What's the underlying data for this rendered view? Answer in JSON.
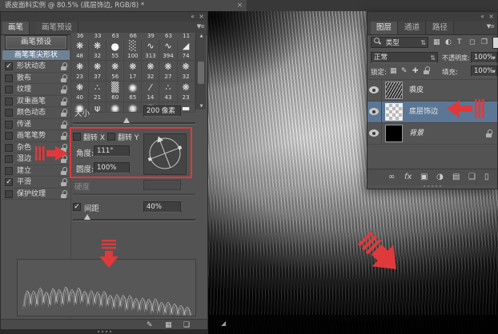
{
  "window": {
    "doc_tab_title": "裘皮面料实例 @ 80.5% (底层饰边, RGB/8) *",
    "doc_tab_close": "×"
  },
  "icons": {
    "check": "✓",
    "reset": "↺",
    "collapse": "«",
    "close": "×",
    "panel_menu": "▼≡",
    "updown": "⇅",
    "dropdown": "▾",
    "scroll_up": "▲",
    "scroll_down": "▼",
    "grip": "◢"
  },
  "brush_panel": {
    "tab_brush": "画笔",
    "tab_presets": "画笔预设",
    "preset_button": "画笔预设",
    "sections": [
      {
        "label": "画笔笔尖形状",
        "selected": true
      },
      {
        "label": "形状动态",
        "checked": true,
        "locked": true
      },
      {
        "label": "散布",
        "checked": false,
        "locked": true
      },
      {
        "label": "纹理",
        "checked": false,
        "locked": true
      },
      {
        "label": "双重画笔",
        "checked": false,
        "locked": true
      },
      {
        "label": "颜色动态",
        "checked": false,
        "locked": true
      },
      {
        "label": "传递",
        "checked": false,
        "locked": true
      },
      {
        "label": "画笔笔势",
        "checked": false,
        "locked": true
      },
      {
        "label": "杂色",
        "checked": false,
        "locked": true
      },
      {
        "label": "湿边",
        "checked": false,
        "locked": true
      },
      {
        "label": "建立",
        "checked": false,
        "locked": true
      },
      {
        "label": "平滑",
        "checked": true,
        "locked": true
      },
      {
        "label": "保护纹理",
        "checked": false,
        "locked": true
      }
    ],
    "grid": {
      "top_numbers": [
        "36",
        "33",
        "63",
        "66",
        "39",
        "63",
        "11"
      ],
      "rows": [
        [
          {
            "n": "48",
            "t": "scatter"
          },
          {
            "n": "32",
            "t": "scatter"
          },
          {
            "n": "55",
            "t": "hard"
          },
          {
            "n": "100",
            "t": "shade"
          },
          {
            "n": "313",
            "t": "curve"
          },
          {
            "n": "394",
            "t": "curve"
          },
          {
            "n": "74",
            "t": "fan"
          }
        ],
        [
          {
            "n": "23",
            "t": "scatter"
          },
          {
            "n": "37",
            "t": "scatter"
          },
          {
            "n": "56",
            "t": "scatter"
          },
          {
            "n": "17",
            "t": "scatter"
          },
          {
            "n": "32",
            "t": "scatter"
          },
          {
            "n": "27",
            "t": "scatter"
          },
          {
            "n": "32",
            "t": "scatter"
          }
        ],
        [
          {
            "n": "40",
            "t": "scatter"
          },
          {
            "n": "21",
            "t": "dots"
          },
          {
            "n": "60",
            "t": "dense"
          },
          {
            "n": "65",
            "t": "soft"
          },
          {
            "n": "14",
            "t": "tick"
          },
          {
            "n": "43",
            "t": "dots"
          },
          {
            "n": "23",
            "t": "scatter"
          }
        ]
      ],
      "partial_row": [
        "soft",
        "grass",
        "soft",
        "soft",
        "soft",
        "flat",
        "flat"
      ]
    },
    "thumb_glyphs": {
      "scatter": "❋",
      "hard": "●",
      "shade": "░",
      "dense": "▒",
      "curve": "∿",
      "fan": "◢",
      "dots": "∴",
      "soft": "●",
      "tick": "⁄",
      "grass": "ψ",
      "flat": "▬"
    },
    "size_label": "大小",
    "size_value": "200 像素",
    "flip_x_label": "翻转 X",
    "flip_y_label": "翻转 Y",
    "angle_label": "角度:",
    "angle_value": "111°",
    "roundness_label": "圆度:",
    "roundness_value": "100%",
    "hardness_label": "硬度",
    "spacing_label": "间距",
    "spacing_value": "40%",
    "bottom_icons": [
      {
        "name": "brush-stroke-preview-icon",
        "glyph": "✎"
      },
      {
        "name": "preset-manager-icon",
        "glyph": "▦"
      },
      {
        "name": "new-brush-icon",
        "glyph": "❑"
      }
    ]
  },
  "layers_panel": {
    "tabs": [
      "图层",
      "通道",
      "路径"
    ],
    "kind_label": "类型",
    "filter_icons": [
      {
        "name": "filter-pixel-layers-icon",
        "glyph": "▦"
      },
      {
        "name": "filter-adjustment-layers-icon",
        "glyph": "◐"
      },
      {
        "name": "filter-type-layers-icon",
        "glyph": "T"
      },
      {
        "name": "filter-shape-layers-icon",
        "glyph": "◻"
      },
      {
        "name": "filter-smart-objects-icon",
        "glyph": "❐"
      }
    ],
    "blend_mode": "正常",
    "opacity_label": "不透明度:",
    "opacity_value": "100%",
    "lock_label": "锁定:",
    "lock_icons": [
      {
        "name": "lock-transparent-pixels-icon",
        "glyph": "▦"
      },
      {
        "name": "lock-image-pixels-icon",
        "glyph": "✎"
      },
      {
        "name": "lock-position-icon",
        "glyph": "✚"
      },
      {
        "name": "lock-all-icon",
        "glyph": ""
      }
    ],
    "fill_label": "填充:",
    "fill_value": "100%",
    "layers": [
      {
        "name": "裘皮",
        "thumb": "fur",
        "visible": true
      },
      {
        "name": "底层饰边",
        "thumb": "checker",
        "visible": true,
        "selected": true
      },
      {
        "name": "背景",
        "thumb": "black",
        "visible": true,
        "locked": true,
        "italic": true
      }
    ],
    "bottom_icons": [
      {
        "name": "link-layers-icon",
        "glyph": "∞"
      },
      {
        "name": "layer-style-icon",
        "glyph": "fx"
      },
      {
        "name": "layer-mask-icon",
        "glyph": "▣"
      },
      {
        "name": "adjustment-layer-icon",
        "glyph": "◑"
      },
      {
        "name": "new-group-icon",
        "glyph": "▤"
      },
      {
        "name": "new-layer-icon",
        "glyph": "❑"
      },
      {
        "name": "delete-layer-icon",
        "glyph": "▯"
      }
    ]
  },
  "colors": {
    "accent_red": "#e0393b",
    "selection_blue": "#5b7795",
    "panel_bg": "#535353"
  }
}
